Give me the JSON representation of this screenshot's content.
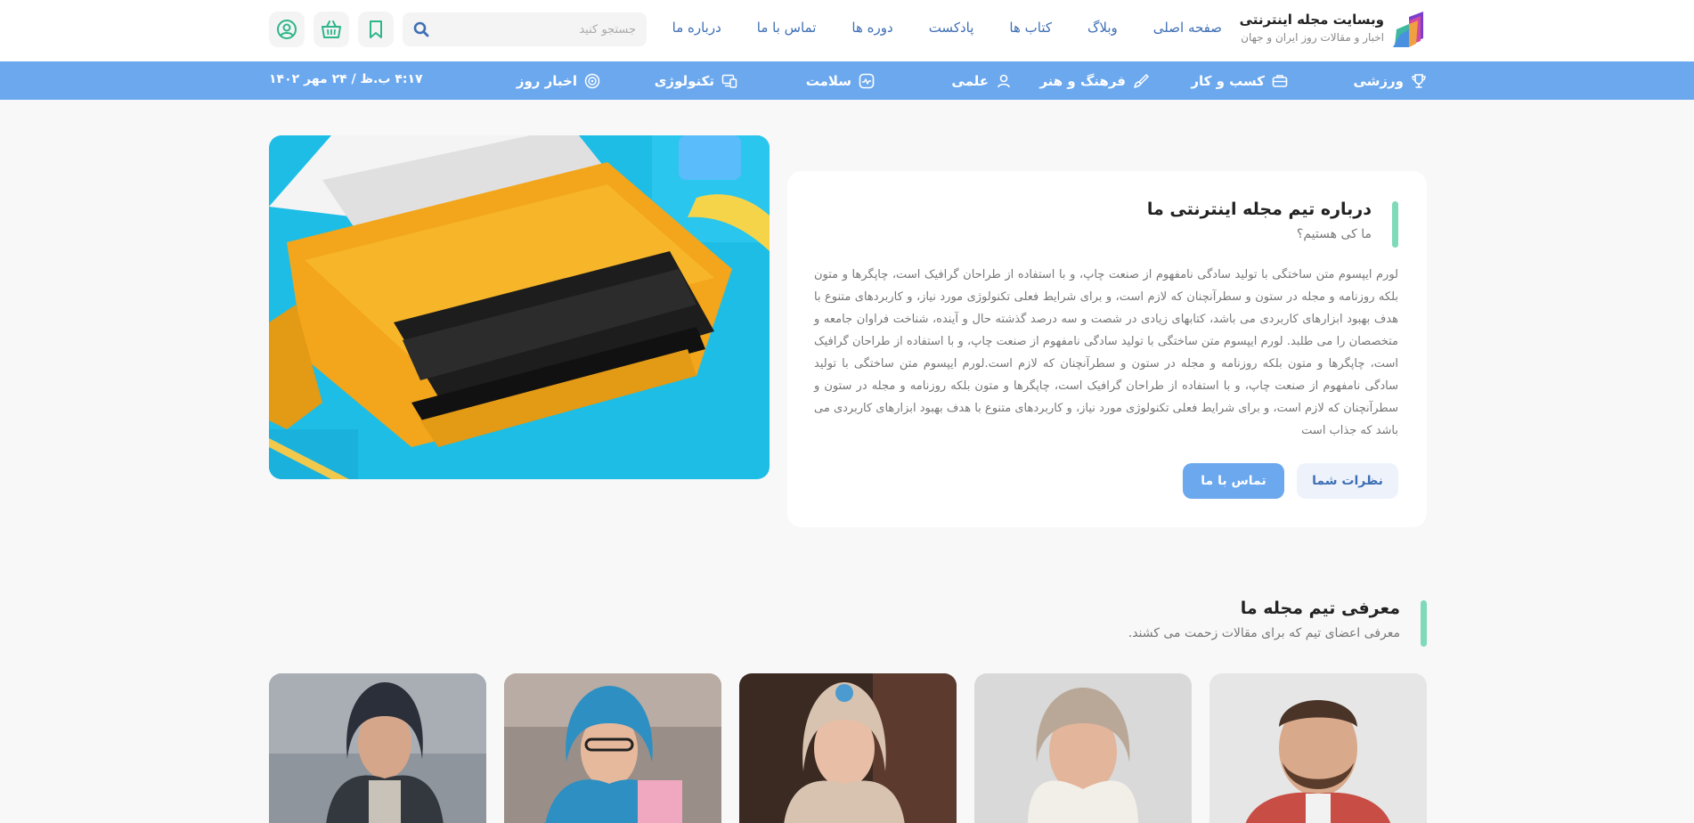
{
  "brand": {
    "title": "وبسایت مجله اینترنتی",
    "subtitle": "اخبار و مقالات روز ایران و جهان",
    "colors": {
      "primary": "#6ba8ee",
      "accent": "#7edab8",
      "link": "#3e6fb5",
      "icon": "#2fb58a"
    }
  },
  "nav": {
    "items": [
      {
        "label": "صفحه اصلی"
      },
      {
        "label": "وبلاگ"
      },
      {
        "label": "کتاب ها"
      },
      {
        "label": "پادکست"
      },
      {
        "label": "دوره ها"
      },
      {
        "label": "تماس با ما"
      },
      {
        "label": "درباره ما"
      }
    ]
  },
  "search": {
    "placeholder": "جستجو کنید",
    "icon": "search-icon"
  },
  "header_actions": [
    {
      "icon": "bookmark-icon"
    },
    {
      "icon": "basket-icon"
    },
    {
      "icon": "user-icon"
    }
  ],
  "categories": [
    {
      "label": "ورزشی",
      "icon": "trophy-icon"
    },
    {
      "label": "کسب و کار",
      "icon": "briefcase-icon"
    },
    {
      "label": "فرهنگ و هنر",
      "icon": "brush-icon"
    },
    {
      "label": "علمی",
      "icon": "person-icon"
    },
    {
      "label": "سلامت",
      "icon": "heart-icon"
    },
    {
      "label": "تکنولوژی",
      "icon": "devices-icon"
    },
    {
      "label": "اخبار روز",
      "icon": "news-icon"
    }
  ],
  "datetime": "۴:۱۷ ب.ظ / ۲۴ مهر ۱۴۰۲",
  "about": {
    "title": "درباره تیم مجله اینترنتی ما",
    "subtitle": "ما کی هستیم؟",
    "body": "لورم ایپسوم متن ساختگی با تولید سادگی نامفهوم از صنعت چاپ، و با استفاده از طراحان گرافیک است، چاپگرها و متون بلکه روزنامه و مجله در ستون و سطرآنچنان که لازم است، و برای شرایط فعلی تکنولوژی مورد نیاز، و کاربردهای متنوع با هدف بهبود ابزارهای کاربردی می باشد، کتابهای زیادی در شصت و سه درصد گذشته حال و آینده، شناخت فراوان جامعه و متخصصان را می طلبد. لورم ایپسوم متن ساختگی با تولید سادگی نامفهوم از صنعت چاپ، و با استفاده از طراحان گرافیک است، چاپگرها و متون بلکه روزنامه و مجله در ستون و سطرآنچنان که لازم است.لورم ایپسوم متن ساختگی با تولید سادگی نامفهوم از صنعت چاپ، و با استفاده از طراحان گرافیک است، چاپگرها و متون بلکه روزنامه و مجله در ستون و سطرآنچنان که لازم است، و برای شرایط فعلی تکنولوژی مورد نیاز، و کاربردهای متنوع با هدف بهبود ابزارهای کاربردی می باشد که جذاب است",
    "primary_button": "تماس با ما",
    "secondary_button": "نظرات شما"
  },
  "team": {
    "title": "معرفی تیم مجله ما",
    "subtitle": "معرفی اعضای تیم که برای مقالات زحمت می کشند."
  }
}
